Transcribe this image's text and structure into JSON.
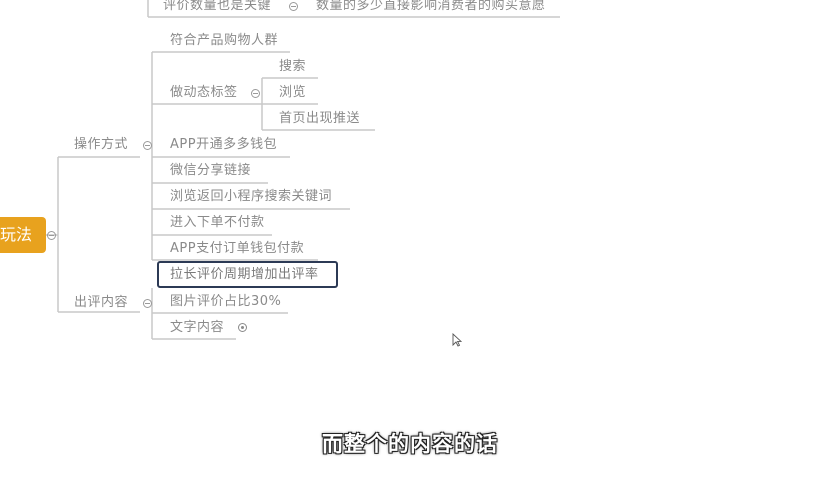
{
  "mindmap": {
    "root": "玩法",
    "top_item": {
      "label": "评价数量也是关键",
      "note": "数量的多少直接影响消费者的购买意愿"
    },
    "branch_operation": {
      "label": "操作方式",
      "items": [
        "符合产品购物人群",
        "做动态标签",
        "APP开通多多钱包",
        "微信分享链接",
        "浏览返回小程序搜索关键词",
        "进入下单不付款",
        "APP支付订单钱包付款"
      ],
      "tag_children": [
        "搜索",
        "浏览",
        "首页出现推送"
      ]
    },
    "branch_review": {
      "label": "出评内容",
      "items": [
        "拉长评价周期增加出评率",
        "图片评价占比30%",
        "文字内容"
      ]
    }
  },
  "subtitle": "而整个的内容的话",
  "colors": {
    "root_bg": "#e8a21e",
    "line": "#c8c8c8",
    "text": "#8a8a8a",
    "selection": "#2c3a55"
  }
}
